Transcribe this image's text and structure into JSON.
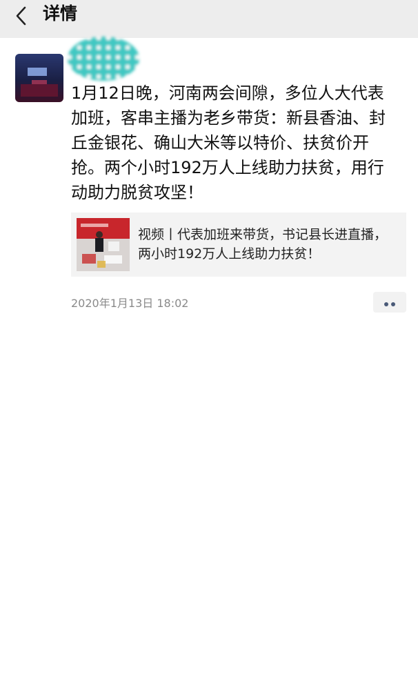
{
  "nav": {
    "title": "详情",
    "back_icon": "chevron-left-icon"
  },
  "post": {
    "author": "",
    "text": "1月12日晚，河南两会间隙，多位人大代表加班，客串主播为老乡带货：新县香油、封丘金银花、确山大米等以特价、扶贫价开抢。两个小时192万人上线助力扶贫，用行动助力脱贫攻坚！",
    "link": {
      "title": "视频丨代表加班来带货，书记县长进直播，两小时192万人上线助力扶贫！"
    },
    "timestamp": "2020年1月13日 18:02",
    "more_icon": "more-dots-icon"
  },
  "colors": {
    "nav_bg": "#ededed",
    "card_bg": "#f3f3f3",
    "timestamp": "#8a8a8a",
    "nickname_mask": "#3fc8c2",
    "more_dots": "#4a5a78"
  }
}
